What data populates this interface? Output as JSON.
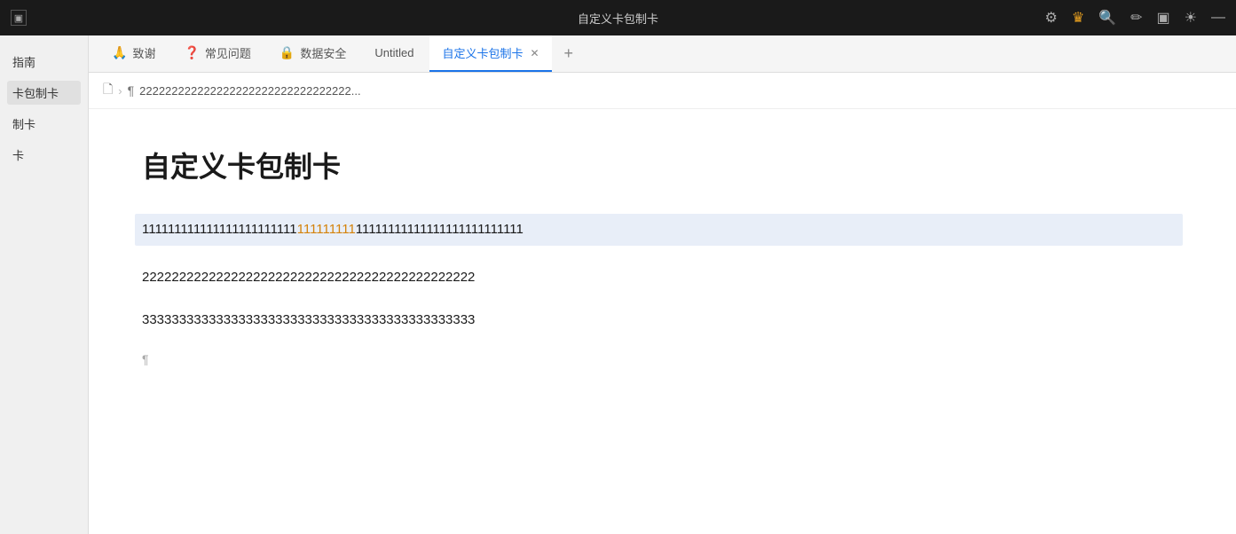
{
  "titlebar": {
    "window_icon": "▣",
    "title": "自定义卡包制卡",
    "icons": {
      "settings": "⚙",
      "crown": "♛",
      "search": "🔍",
      "edit": "✏",
      "layout": "▣",
      "brightness": "☀",
      "minimize": "—"
    }
  },
  "tabs": [
    {
      "id": "tab-thanks",
      "icon": "🙏",
      "label": "致谢",
      "active": false,
      "closable": false
    },
    {
      "id": "tab-faq",
      "icon": "❓",
      "label": "常见问题",
      "active": false,
      "closable": false
    },
    {
      "id": "tab-security",
      "icon": "🔒",
      "label": "数据安全",
      "active": false,
      "closable": false
    },
    {
      "id": "tab-untitled",
      "icon": "",
      "label": "Untitled",
      "active": false,
      "closable": false
    },
    {
      "id": "tab-custom-card",
      "icon": "",
      "label": "自定义卡包制卡",
      "active": true,
      "closable": true
    }
  ],
  "tab_add_label": "+",
  "breadcrumb": {
    "doc_icon": "🗋",
    "sep": "›",
    "para_icon": "¶",
    "path_text": "222222222222222222222222222222222..."
  },
  "sidebar": {
    "items": [
      {
        "id": "sidebar-guide",
        "label": "指南",
        "active": false
      },
      {
        "id": "sidebar-card-maker",
        "label": "卡包制卡",
        "active": true
      },
      {
        "id": "sidebar-make-card",
        "label": "制卡",
        "active": false
      },
      {
        "id": "sidebar-card",
        "label": "卡",
        "active": false
      }
    ]
  },
  "editor": {
    "title": "自定义卡包制卡",
    "lines": [
      {
        "id": "line1",
        "highlighted": true,
        "before_highlight": "111111111111111111111111",
        "highlight_text": "111111111",
        "after_highlight": "11111111111111111111111111"
      },
      {
        "id": "line2",
        "highlighted": false,
        "text": "222222222222222222222222222222222222222222222"
      },
      {
        "id": "line3",
        "highlighted": false,
        "text": "333333333333333333333333333333333333333333333"
      }
    ],
    "para_mark": "¶"
  },
  "colors": {
    "active_tab_line": "#1a73e8",
    "highlight_bg": "#e8eef8",
    "highlight_text": "#d4820a"
  }
}
